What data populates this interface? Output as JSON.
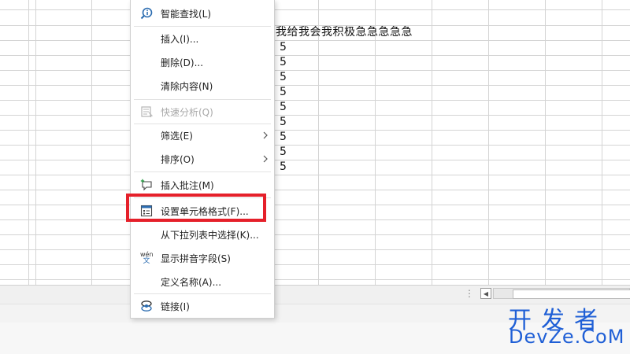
{
  "sheet": {
    "header_text": "我给我会我积极急急急急急",
    "values": [
      "5",
      "5",
      "5",
      "5",
      "5",
      "5",
      "5",
      "5",
      "5"
    ]
  },
  "context_menu": {
    "items": [
      {
        "label": "智能查找(L)",
        "icon": "smart-lookup-icon",
        "enabled": true
      },
      {
        "label": "插入(I)...",
        "icon": "",
        "enabled": true
      },
      {
        "label": "删除(D)...",
        "icon": "",
        "enabled": true
      },
      {
        "label": "清除内容(N)",
        "icon": "",
        "enabled": true
      },
      {
        "label": "快速分析(Q)",
        "icon": "quick-analysis-icon",
        "enabled": false
      },
      {
        "label": "筛选(E)",
        "icon": "",
        "enabled": true,
        "submenu": true
      },
      {
        "label": "排序(O)",
        "icon": "",
        "enabled": true,
        "submenu": true
      },
      {
        "label": "插入批注(M)",
        "icon": "insert-comment-icon",
        "enabled": true
      },
      {
        "label": "设置单元格格式(F)...",
        "icon": "format-cells-icon",
        "enabled": true,
        "highlighted": true
      },
      {
        "label": "从下拉列表中选择(K)...",
        "icon": "",
        "enabled": true
      },
      {
        "label": "显示拼音字段(S)",
        "icon": "phonetic-icon",
        "enabled": true
      },
      {
        "label": "定义名称(A)...",
        "icon": "",
        "enabled": true
      },
      {
        "label": "链接(I)",
        "icon": "link-icon",
        "enabled": true
      }
    ]
  },
  "phonetic_icon_text": {
    "top": "wén",
    "bottom": "文"
  },
  "status": {
    "dots": "⋮",
    "scroll_left": "◀"
  },
  "watermark": {
    "cn": "开发者",
    "en": "DevZe.CoM"
  },
  "colors": {
    "highlight": "#e5202a",
    "watermark": "#1f5fd6",
    "icon_blue": "#2b6cb0"
  }
}
